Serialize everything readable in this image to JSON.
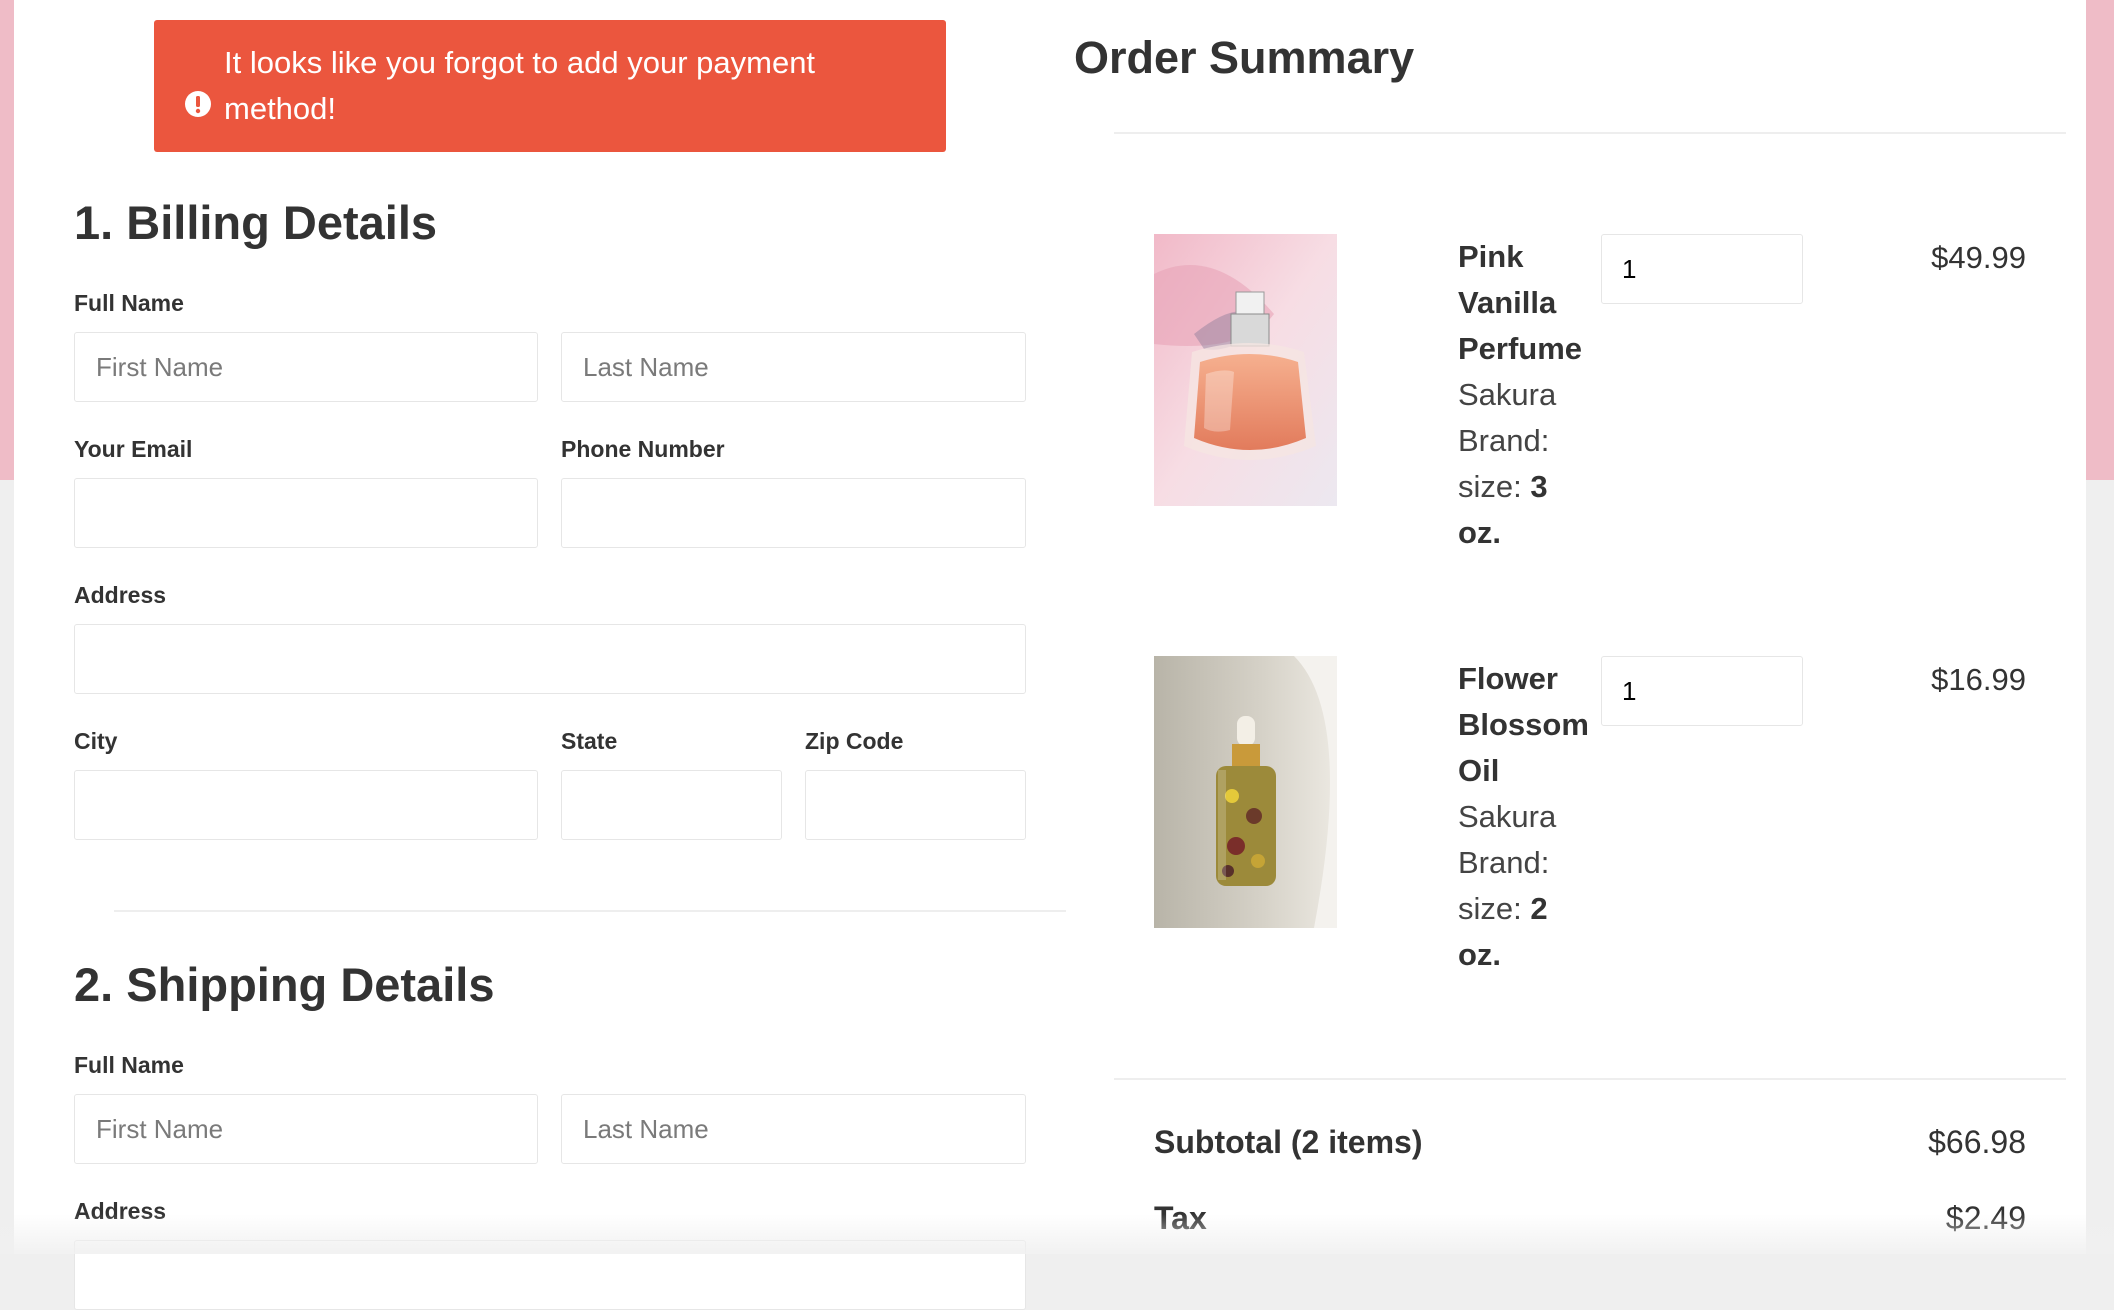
{
  "alert": {
    "icon": "exclamation-circle-icon",
    "message": "It looks like you forgot to add your payment method!"
  },
  "billing": {
    "title": "1. Billing Details",
    "full_name_label": "Full Name",
    "first_name_placeholder": "First Name",
    "last_name_placeholder": "Last Name",
    "email_label": "Your Email",
    "phone_label": "Phone Number",
    "address_label": "Address",
    "city_label": "City",
    "state_label": "State",
    "zip_label": "Zip Code"
  },
  "shipping": {
    "title": "2. Shipping Details",
    "full_name_label": "Full Name",
    "first_name_placeholder": "First Name",
    "last_name_placeholder": "Last Name",
    "address_label": "Address"
  },
  "summary": {
    "title": "Order Summary",
    "items": [
      {
        "name": "Pink Vanilla Perfume",
        "brand": "Sakura Brand:",
        "size_label": "size:",
        "size_value": "3 oz.",
        "quantity": "1",
        "price": "$49.99",
        "image_icon": "perfume-bottle-image"
      },
      {
        "name": "Flower Blossom Oil",
        "brand": "Sakura Brand:",
        "size_label": "size:",
        "size_value": "2 oz.",
        "quantity": "1",
        "price": "$16.99",
        "image_icon": "oil-dropper-bottle-image"
      }
    ],
    "subtotal_label": "Subtotal (2 items)",
    "subtotal_value": "$66.98",
    "tax_label": "Tax",
    "tax_value": "$2.49"
  },
  "colors": {
    "alert": "#eb563e",
    "band": "#efbcc7",
    "text": "#333333"
  }
}
